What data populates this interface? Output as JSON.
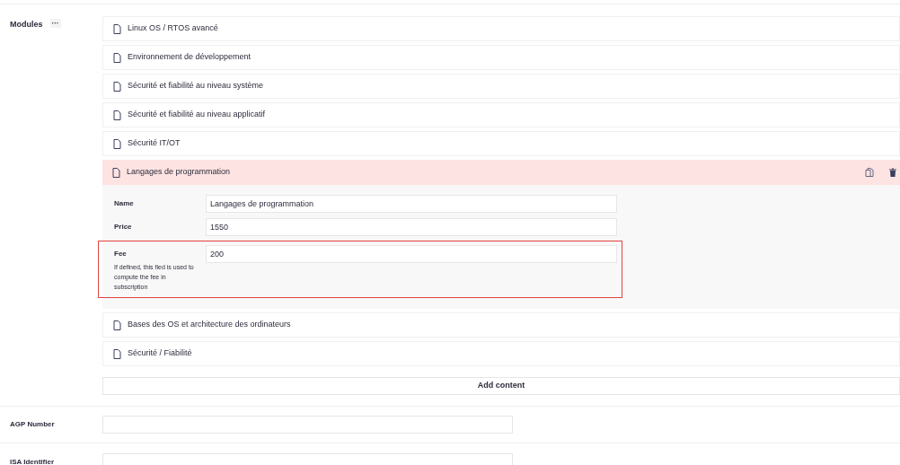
{
  "modules": {
    "label": "Modules",
    "menu": "···",
    "items": [
      {
        "title": "Linux OS / RTOS avancé",
        "expanded": false
      },
      {
        "title": "Environnement de développement",
        "expanded": false
      },
      {
        "title": "Sécurité et fiabilité au niveau système",
        "expanded": false
      },
      {
        "title": "Sécurité et fiabilité au niveau applicatif",
        "expanded": false
      },
      {
        "title": "Sécurité IT/OT",
        "expanded": false
      },
      {
        "title": "Langages de programmation",
        "expanded": true,
        "fields": [
          {
            "label": "Name",
            "value": "Langages de programmation",
            "highlighted": false
          },
          {
            "label": "Price",
            "value": "1550",
            "highlighted": false
          },
          {
            "label": "Fee",
            "value": "200",
            "help": "If defined, this fied is used to compute the fee in subscription",
            "highlighted": true
          }
        ]
      },
      {
        "title": "Bases des OS et architecture des ordinateurs",
        "expanded": false
      },
      {
        "title": "Sécurité / Fiabilité",
        "expanded": false
      }
    ],
    "add_button": "Add content"
  },
  "fields": [
    {
      "label": "AGP Number"
    },
    {
      "label": "ISA Identifier"
    }
  ]
}
